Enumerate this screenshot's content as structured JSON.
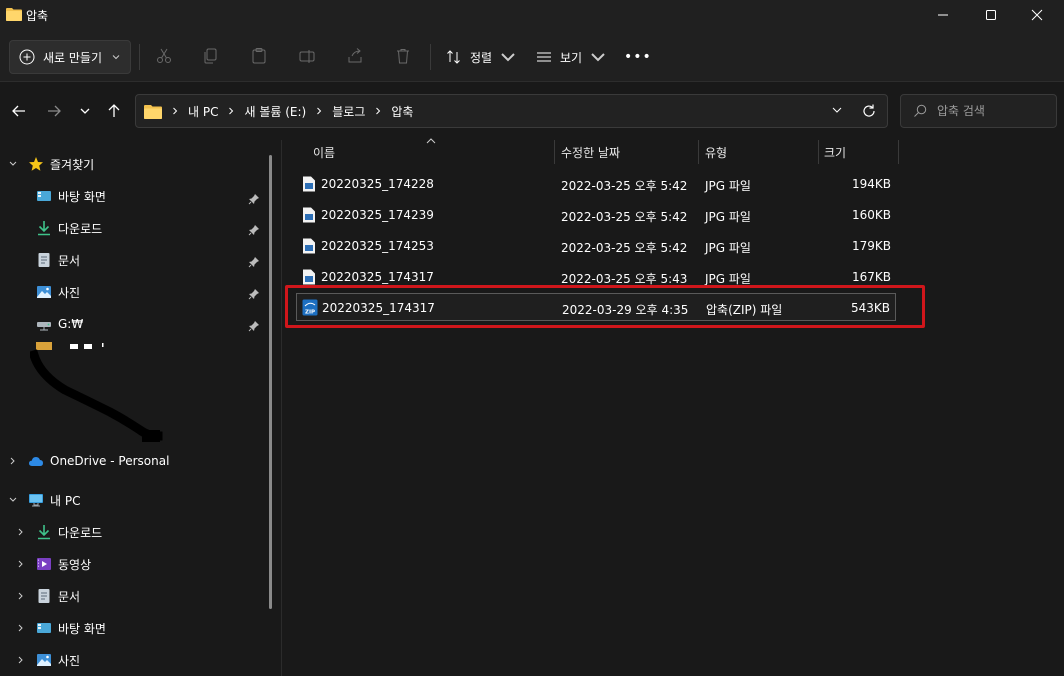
{
  "window": {
    "title": "압축"
  },
  "toolbar": {
    "new_label": "새로 만들기",
    "sort_label": "정렬",
    "view_label": "보기",
    "more_label": "•••"
  },
  "address": {
    "crumbs": [
      "내 PC",
      "새 볼륨 (E:)",
      "블로그",
      "압축"
    ]
  },
  "search": {
    "placeholder": "압축 검색"
  },
  "sidebar": {
    "favorites_label": "즐겨찾기",
    "favorites": [
      {
        "label": "바탕 화면",
        "icon": "desktop-icon"
      },
      {
        "label": "다운로드",
        "icon": "download-icon"
      },
      {
        "label": "문서",
        "icon": "document-icon"
      },
      {
        "label": "사진",
        "icon": "pictures-icon"
      },
      {
        "label": "G:₩",
        "icon": "network-drive-icon"
      }
    ],
    "onedrive_label": "OneDrive - Personal",
    "thispc_label": "내 PC",
    "thispc_items": [
      {
        "label": "다운로드",
        "icon": "download-icon"
      },
      {
        "label": "동영상",
        "icon": "videos-icon"
      },
      {
        "label": "문서",
        "icon": "document-icon"
      },
      {
        "label": "바탕 화면",
        "icon": "desktop-icon"
      },
      {
        "label": "사진",
        "icon": "pictures-icon"
      }
    ]
  },
  "columns": {
    "name": "이름",
    "date": "수정한 날짜",
    "type": "유형",
    "size": "크기"
  },
  "files": [
    {
      "name": "20220325_174228",
      "date": "2022-03-25 오후 5:42",
      "type": "JPG 파일",
      "size": "194KB",
      "icon": "jpg-file-icon"
    },
    {
      "name": "20220325_174239",
      "date": "2022-03-25 오후 5:42",
      "type": "JPG 파일",
      "size": "160KB",
      "icon": "jpg-file-icon"
    },
    {
      "name": "20220325_174253",
      "date": "2022-03-25 오후 5:42",
      "type": "JPG 파일",
      "size": "179KB",
      "icon": "jpg-file-icon"
    },
    {
      "name": "20220325_174317",
      "date": "2022-03-25 오후 5:43",
      "type": "JPG 파일",
      "size": "167KB",
      "icon": "jpg-file-icon"
    },
    {
      "name": "20220325_174317",
      "date": "2022-03-29 오후 4:35",
      "type": "압축(ZIP) 파일",
      "size": "543KB",
      "icon": "zip-file-icon"
    }
  ],
  "colors": {
    "highlight": "#d0161b",
    "folder": "#f2c14e",
    "accent": "#4cc2ff"
  }
}
